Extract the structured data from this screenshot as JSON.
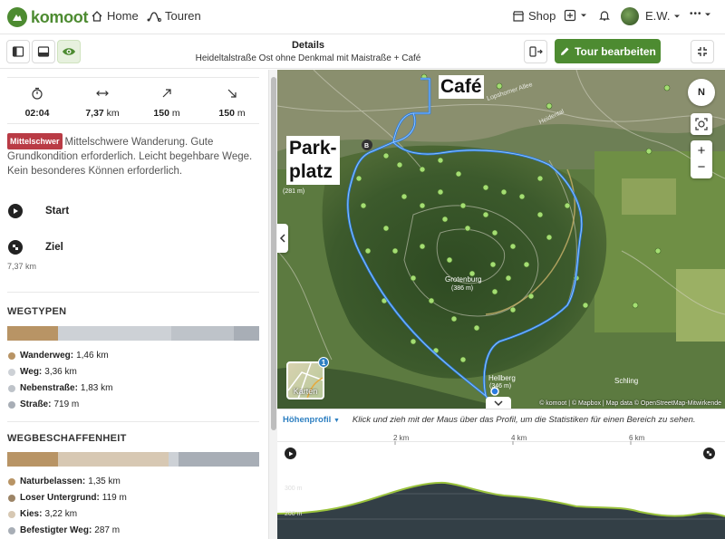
{
  "topnav": {
    "logo": "komoot",
    "home": "Home",
    "tours": "Touren",
    "shop": "Shop",
    "user": "E.W.",
    "more": "•••"
  },
  "subheader": {
    "title": "Details",
    "subtitle": "Heideltalstraße Ost ohne Denkmal mit Maistraße + Café",
    "edit": "Tour bearbeiten"
  },
  "stats": [
    {
      "icon": "timer-icon",
      "value": "02:04",
      "unit": ""
    },
    {
      "icon": "distance-icon",
      "value": "7,37",
      "unit": "km"
    },
    {
      "icon": "uphill-icon",
      "value": "150",
      "unit": "m"
    },
    {
      "icon": "downhill-icon",
      "value": "150",
      "unit": "m"
    }
  ],
  "difficulty": {
    "badge": "Mittelschwer",
    "text": "Mittelschwere Wanderung. Gute Grundkondition erforderlich. Leicht begehbare Wege. Kein besonderes Können erforderlich."
  },
  "waypoints": {
    "start": "Start",
    "end": "Ziel",
    "end_distance": "7,37 km"
  },
  "wegtypen": {
    "title": "WEGTYPEN",
    "segments": [
      {
        "color": "#b89465",
        "share": 0.2
      },
      {
        "color": "#cdd1d6",
        "share": 0.45
      },
      {
        "color": "#bec3c9",
        "share": 0.25
      },
      {
        "color": "#a8aeb6",
        "share": 0.1
      }
    ],
    "items": [
      {
        "label": "Wanderweg:",
        "value": "1,46 km",
        "color": "#b89465"
      },
      {
        "label": "Weg:",
        "value": "3,36 km",
        "color": "#cdd1d6"
      },
      {
        "label": "Nebenstraße:",
        "value": "1,83 km",
        "color": "#bec3c9"
      },
      {
        "label": "Straße:",
        "value": "719 m",
        "color": "#a8aeb6"
      }
    ]
  },
  "wegbeschaffenheit": {
    "title": "WEGBESCHAFFENHEIT",
    "segments": [
      {
        "color": "#b89465",
        "share": 0.2
      },
      {
        "color": "#d7c8b3",
        "share": 0.44
      },
      {
        "color": "#cdd1d6",
        "share": 0.04
      },
      {
        "color": "#a8aeb6",
        "share": 0.32
      }
    ],
    "items": [
      {
        "label": "Naturbelassen:",
        "value": "1,35 km",
        "color": "#b89465"
      },
      {
        "label": "Loser Untergrund:",
        "value": "119 m",
        "color": "#9c8466"
      },
      {
        "label": "Kies:",
        "value": "3,22 km",
        "color": "#d7c8b3"
      },
      {
        "label": "Befestigter Weg:",
        "value": "287 m",
        "color": "#a8aeb6"
      }
    ]
  },
  "map": {
    "label_cafe": "Café",
    "label_park1": "Park-",
    "label_park2": "platz",
    "peak1": "Grotenburg",
    "peak1_h": "(386 m)",
    "peak2": "Hellberg",
    "peak2_h": "(346 m)",
    "peak3_h": "(281 m)",
    "village": "Schling",
    "road1": "Lopshorner Allee",
    "road2": "Heidental",
    "karten": "Karten",
    "karten_badge": "1",
    "compass": "N",
    "zoom_in": "+",
    "zoom_out": "−",
    "attribution": "© komoot | © Mapbox | Map data © OpenStreetMap-Mitwirkende"
  },
  "elevation": {
    "title": "Höhenprofil",
    "hint": "Klick und zieh mit der Maus über das Profil, um die Statistiken für einen Bereich zu sehen.",
    "km_labels": [
      "2 km",
      "4 km",
      "6 km"
    ],
    "y_labels": [
      "300 m",
      "200 m"
    ]
  }
}
